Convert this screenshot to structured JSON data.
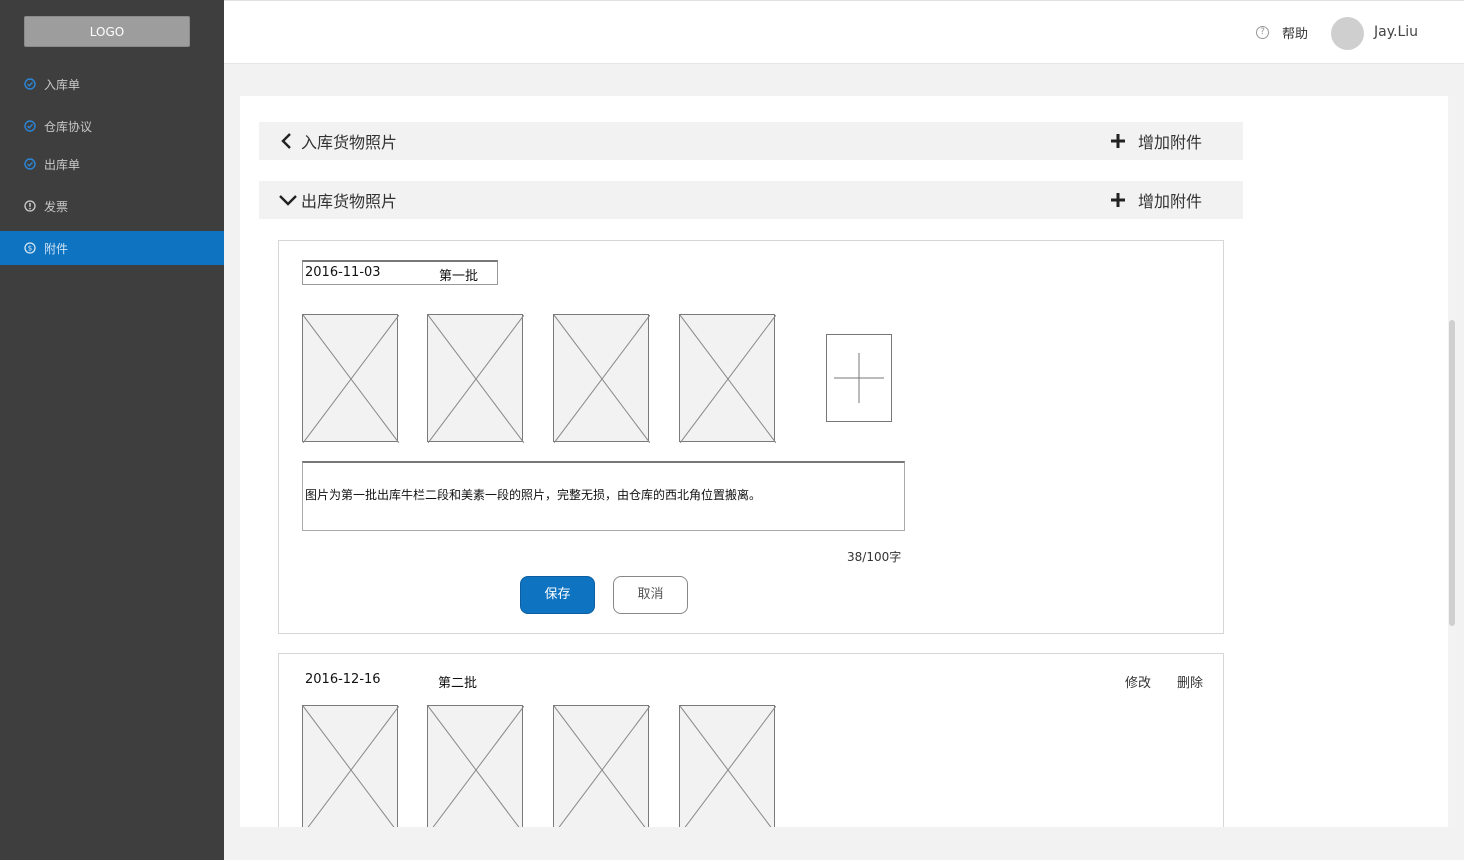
{
  "sidebar": {
    "logo": "LOGO",
    "items": [
      {
        "label": "入库单",
        "icon": "check-circle-icon"
      },
      {
        "label": "仓库协议",
        "icon": "check-circle-icon"
      },
      {
        "label": "出库单",
        "icon": "check-circle-icon"
      },
      {
        "label": "发票",
        "icon": "info-circle-icon"
      },
      {
        "label": "附件",
        "icon": "dollar-circle-icon",
        "active": true
      }
    ]
  },
  "header": {
    "help_label": "帮助",
    "help_icon": "question-circle-icon",
    "username": "Jay.Liu"
  },
  "sections": [
    {
      "title": "入库货物照片",
      "add_label": "增加附件",
      "expanded": false
    },
    {
      "title": "出库货物照片",
      "add_label": "增加附件",
      "expanded": true
    }
  ],
  "batches": [
    {
      "date": "2016-11-03",
      "batch": "第一批",
      "editing": true,
      "photo_count": 4,
      "description": "图片为第一批出库牛栏二段和美素一段的照片，完整无损，由仓库的西北角位置搬离。",
      "counter": "38/100字",
      "save_label": "保存",
      "cancel_label": "取消"
    },
    {
      "date": "2016-12-16",
      "batch": "第二批",
      "editing": false,
      "photo_count": 4,
      "edit_label": "修改",
      "delete_label": "删除"
    }
  ],
  "colors": {
    "sidebar_bg": "#3e3e3e",
    "accent": "#0e73c1",
    "section_bg": "#f2f2f2"
  }
}
